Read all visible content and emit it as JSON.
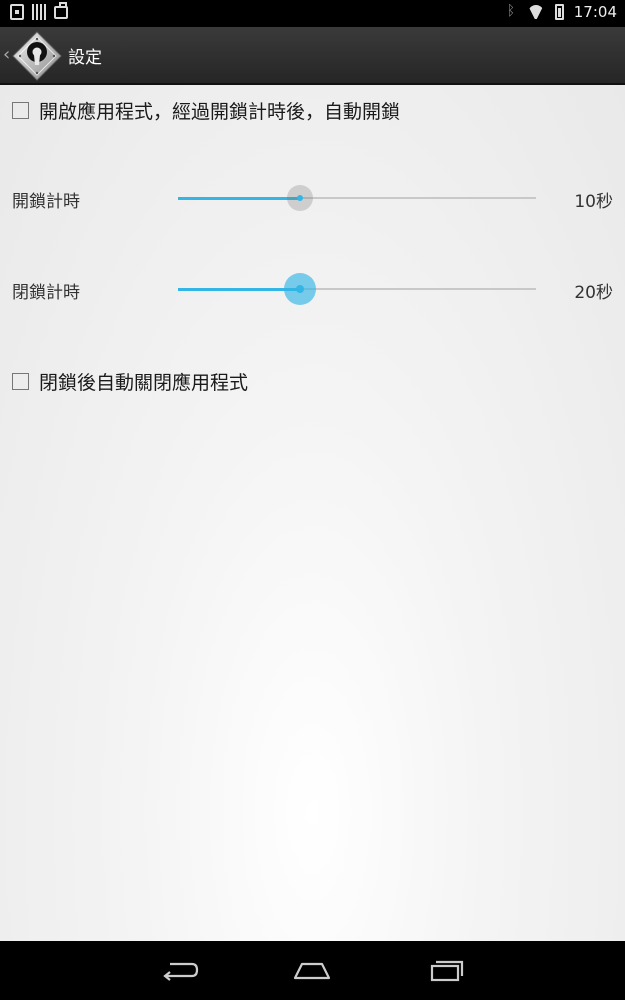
{
  "status_bar": {
    "time": "17:04",
    "left_icons": [
      "phone-icon",
      "barcode-icon",
      "bag-icon"
    ],
    "right_icons": [
      "bluetooth-icon",
      "wifi-icon",
      "battery-icon"
    ]
  },
  "action_bar": {
    "title": "設定",
    "icon": "keyhole-diamond-icon"
  },
  "settings": {
    "auto_unlock": {
      "label": "開啟應用程式，經過開鎖計時後，自動開鎖",
      "checked": false
    },
    "unlock_timer": {
      "label": "開鎖計時",
      "value_text": "10秒",
      "fraction": 0.34
    },
    "lock_timer": {
      "label": "閉鎖計時",
      "value_text": "20秒",
      "fraction": 0.34
    },
    "auto_close": {
      "label": "閉鎖後自動關閉應用程式",
      "checked": false
    }
  },
  "nav_bar": {
    "icons": [
      "back-icon",
      "home-icon",
      "recents-icon"
    ]
  },
  "colors": {
    "accent": "#33b5e5",
    "action_bar": "#2e2e2e",
    "background": "#f0f0f0"
  }
}
